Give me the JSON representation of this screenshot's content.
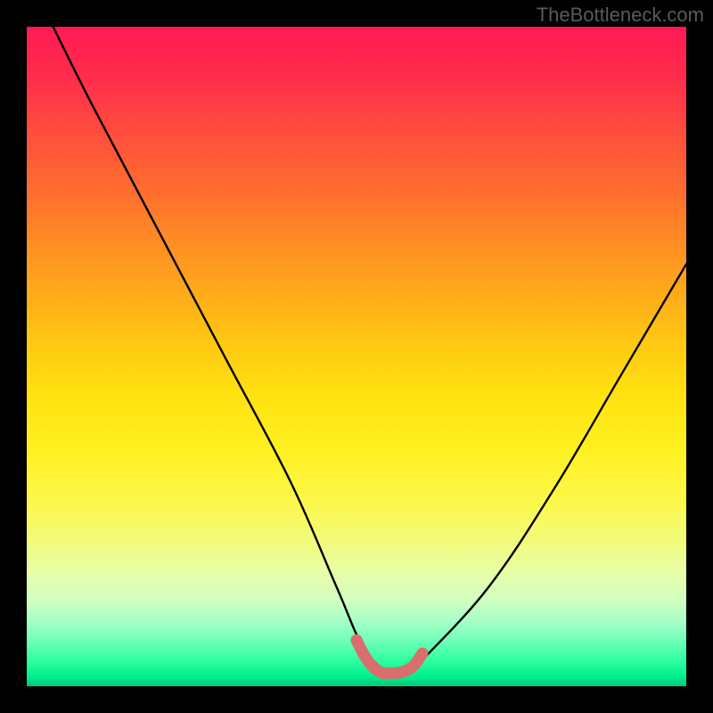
{
  "watermark": "TheBottleneck.com",
  "chart_data": {
    "type": "line",
    "title": "",
    "xlabel": "",
    "ylabel": "",
    "xlim": [
      0,
      100
    ],
    "ylim": [
      0,
      100
    ],
    "series": [
      {
        "name": "bottleneck-curve",
        "x": [
          4,
          10,
          20,
          30,
          40,
          47,
          51,
          55,
          58,
          60,
          70,
          80,
          90,
          100
        ],
        "y": [
          100,
          88,
          69,
          50,
          31,
          15,
          6,
          2,
          2,
          4,
          15,
          30,
          47,
          64
        ]
      }
    ],
    "highlight": {
      "name": "optimal-range",
      "x": [
        50,
        51,
        52,
        53,
        54,
        55,
        56,
        57,
        58,
        59,
        60
      ],
      "y": [
        7,
        5,
        3.5,
        2.5,
        2,
        2,
        2,
        2.2,
        2.6,
        3.5,
        5
      ]
    },
    "gradient_stops": [
      {
        "pos": 0,
        "color": "#ff1a55"
      },
      {
        "pos": 50,
        "color": "#ffe210"
      },
      {
        "pos": 85,
        "color": "#e6feaa"
      },
      {
        "pos": 100,
        "color": "#00c878"
      }
    ]
  }
}
